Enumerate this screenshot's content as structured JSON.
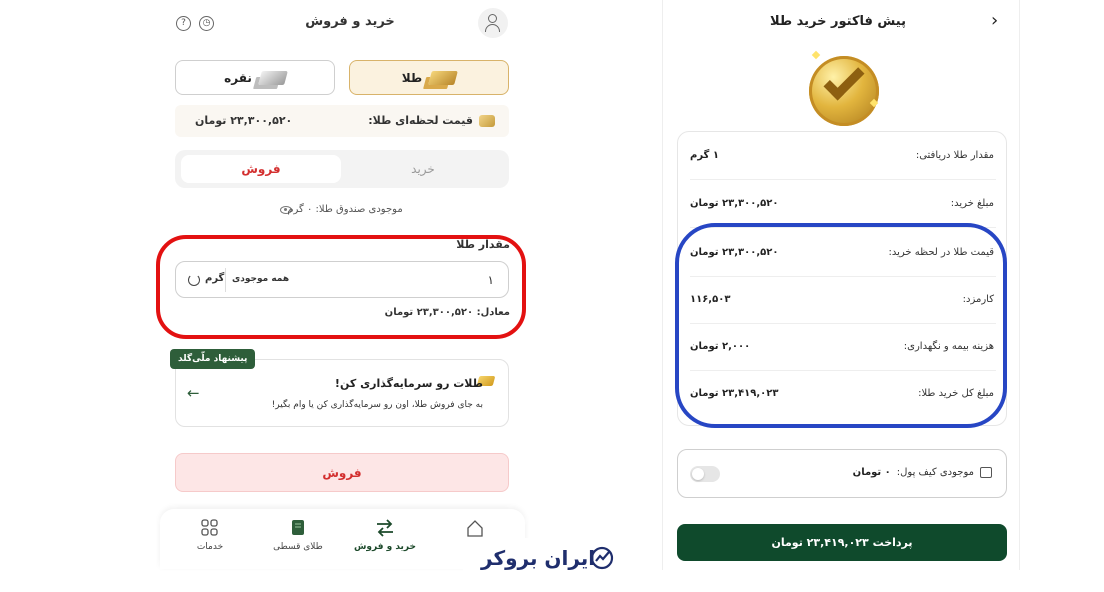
{
  "left_screen": {
    "header": {
      "title": "خرید و فروش"
    },
    "metal_tabs": {
      "gold": "طلا",
      "silver": "نقره"
    },
    "live_price": {
      "label": "قیمت لحظه‌ای طلا:",
      "value": "۲۳,۳۰۰,۵۲۰ تومان"
    },
    "mode_tabs": {
      "buy": "خرید",
      "sell": "فروش",
      "active": "sell"
    },
    "vault_balance": "موجودی صندوق طلا: ۰ گرم",
    "amount": {
      "label": "مقدار طلا",
      "value": "۱",
      "all_balance": "همه موجودی",
      "unit": "گرم",
      "equivalent": "معادل: ۲۳,۳۰۰,۵۲۰ تومان"
    },
    "suggestion": {
      "badge": "پیشنهاد ملّی‌گلد",
      "title": "طلات رو سرمایه‌گذاری کن!",
      "subtitle": "به جای فروش طلا، اون رو سرمایه‌گذاری کن یا وام بگیر!"
    },
    "sell_button": "فروش",
    "bottom_nav": [
      {
        "label": "",
        "icon": "home-icon"
      },
      {
        "label": "خرید و فروش",
        "icon": "swap-icon"
      },
      {
        "label": "طلای قسطی",
        "icon": "installment-icon"
      },
      {
        "label": "خدمات",
        "icon": "services-icon"
      }
    ]
  },
  "logo": {
    "text": "ایران بروکر"
  },
  "right_screen": {
    "header": {
      "title": "پیش فاکتور خرید طلا"
    },
    "invoice": [
      {
        "label": "مقدار طلا دریافتی:",
        "value": "۱ گرم"
      },
      {
        "label": "مبلغ خرید:",
        "value": "۲۳,۳۰۰,۵۲۰ تومان"
      },
      {
        "label": "قیمت طلا در لحظه خرید:",
        "value": "۲۳,۳۰۰,۵۲۰ تومان"
      },
      {
        "label": "کارمزد:",
        "value": "۱۱۶,۵۰۳"
      },
      {
        "label": "هزینه بیمه و نگهداری:",
        "value": "۲,۰۰۰ تومان"
      },
      {
        "label": "مبلغ کل خرید طلا:",
        "value": "۲۳,۴۱۹,۰۲۳ تومان"
      }
    ],
    "wallet": {
      "label": "موجودی کیف پول:",
      "value": "۰ تومان"
    },
    "pay_button": "پرداخت ۲۳,۴۱۹,۰۲۳ تومان"
  },
  "colors": {
    "brand_green": "#0f4a2c",
    "sell_red": "#d32f2f",
    "annotation_red": "#e31111",
    "annotation_blue": "#2746c4",
    "gold_accent": "#d8b36a"
  }
}
